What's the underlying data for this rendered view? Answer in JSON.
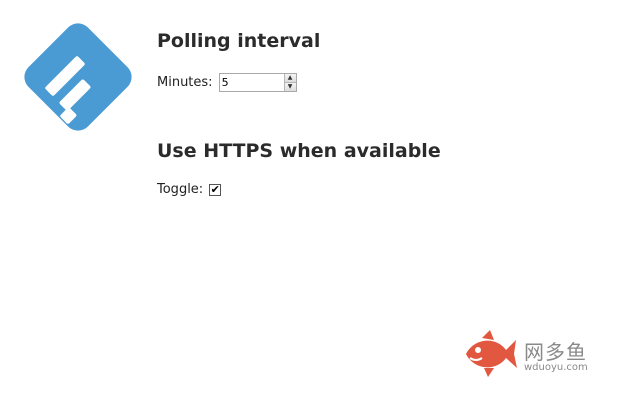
{
  "logo": {
    "icon": "feedly-logo-icon",
    "color": "#4a9ad4"
  },
  "polling": {
    "title": "Polling interval",
    "label": "Minutes:",
    "value": "5"
  },
  "https": {
    "title": "Use HTTPS when available",
    "label": "Toggle:",
    "checked": true,
    "check_glyph": "✔"
  },
  "watermark": {
    "name": "网多鱼",
    "site": "wduoyu.com",
    "icon": "fish-icon",
    "color": "#e2573f"
  }
}
